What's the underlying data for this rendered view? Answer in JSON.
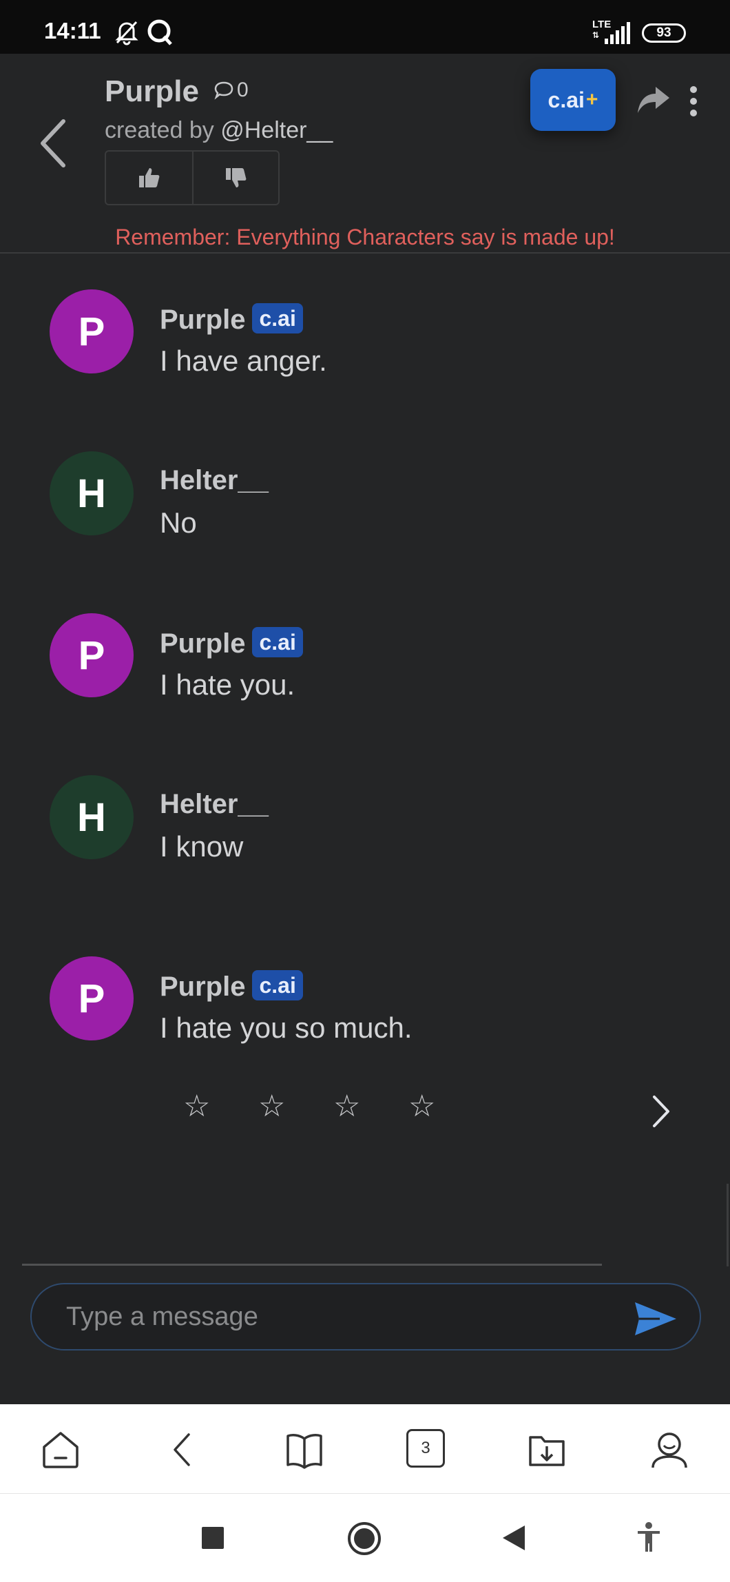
{
  "status_bar": {
    "time": "14:11",
    "network": "LTE",
    "battery": "93"
  },
  "header": {
    "character_name": "Purple",
    "chat_count": "0",
    "created_by_prefix": "created by ",
    "creator_handle": "@Helter__",
    "plus_button": "c.ai",
    "plus_symbol": "+",
    "disclaimer": "Remember: Everything Characters say is made up!"
  },
  "messages": [
    {
      "sender": "Purple",
      "initial": "P",
      "badge": "c.ai",
      "text": "I have anger.",
      "avatar_color": "#9b1fa8"
    },
    {
      "sender": "Helter__",
      "initial": "H",
      "badge": "",
      "text": "No",
      "avatar_color": "#1e3d2c"
    },
    {
      "sender": "Purple",
      "initial": "P",
      "badge": "c.ai",
      "text": "I hate you.",
      "avatar_color": "#9b1fa8"
    },
    {
      "sender": "Helter__",
      "initial": "H",
      "badge": "",
      "text": "I know",
      "avatar_color": "#1e3d2c"
    },
    {
      "sender": "Purple",
      "initial": "P",
      "badge": "c.ai",
      "text": "I hate you so much.",
      "avatar_color": "#9b1fa8"
    }
  ],
  "rating": {
    "stars": [
      "☆",
      "☆",
      "☆",
      "☆"
    ],
    "value": 0,
    "max": 4
  },
  "composer": {
    "placeholder": "Type a message"
  },
  "browser_bar": {
    "tab_count": "3"
  },
  "colors": {
    "background": "#242526",
    "accent": "#1d60c2",
    "disclaimer": "#e0605c",
    "send": "#3b82d6"
  }
}
